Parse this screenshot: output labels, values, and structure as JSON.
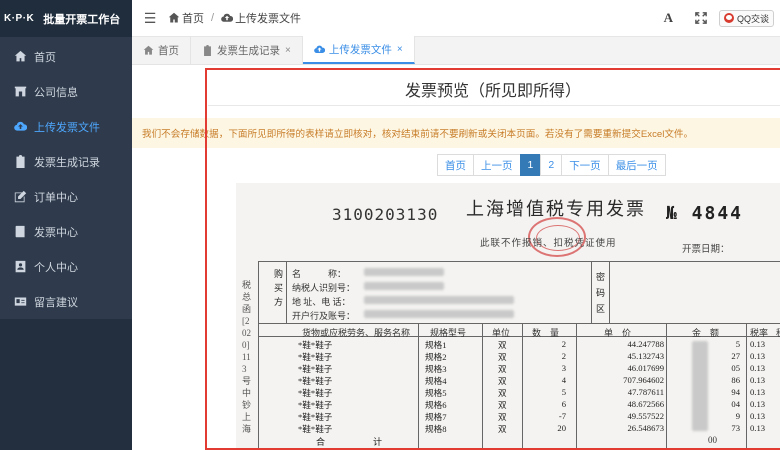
{
  "app": {
    "logo": "K·P·K",
    "title": "批量开票工作台"
  },
  "sidebar": {
    "items": [
      {
        "label": "首页",
        "icon": "home-icon"
      },
      {
        "label": "公司信息",
        "icon": "building-icon"
      },
      {
        "label": "上传发票文件",
        "icon": "cloud-upload-icon"
      },
      {
        "label": "发票生成记录",
        "icon": "clipboard-icon"
      },
      {
        "label": "订单中心",
        "icon": "edit-icon"
      },
      {
        "label": "发票中心",
        "icon": "book-icon"
      },
      {
        "label": "个人中心",
        "icon": "user-icon"
      },
      {
        "label": "留言建议",
        "icon": "id-card-icon"
      }
    ],
    "active_index": 2
  },
  "topbar": {
    "breadcrumb_home": "首页",
    "breadcrumb_current": "上传发票文件",
    "font_button": "A",
    "qq_label": "QQ交谈"
  },
  "tabs": [
    {
      "label": "首页",
      "closable": false
    },
    {
      "label": "发票生成记录",
      "closable": true,
      "close": "×"
    },
    {
      "label": "上传发票文件",
      "closable": true,
      "close": "×",
      "active": true
    }
  ],
  "main": {
    "title": "发票预览（所见即所得）",
    "notice": "我们不会存储数据，下面所见即所得的表样请立即核对，核对结束前请不要刷新或关闭本页面。若没有了需要重新提交Excel文件。",
    "pagination": [
      "首页",
      "上一页",
      "1",
      "2",
      "下一页",
      "最后一页"
    ],
    "current_page": "1"
  },
  "invoice": {
    "code": "3100203130",
    "title": "上海增值税专用发票",
    "number": "№ 4844",
    "subtitle": "此联不作报销、扣税凭证使用",
    "date_label": "开票日期：",
    "side_text": "税总函[2020]113号中钞上海",
    "buyer_label": "购买方",
    "buyer_fields": [
      "名　　　称：",
      "纳税人识别号：",
      "地 址、电 话：",
      "开户行及账号："
    ],
    "password_label": "密码区",
    "headers": [
      "货物或应税劳务、服务名称",
      "规格型号",
      "单位",
      "数　量",
      "单　价",
      "金　额",
      "税率",
      "税"
    ],
    "rows": [
      {
        "name": "*鞋*鞋子",
        "spec": "规格1",
        "unit": "双",
        "qty": "2",
        "price": "44.247788",
        "amt": "5",
        "rate": "0.13"
      },
      {
        "name": "*鞋*鞋子",
        "spec": "规格2",
        "unit": "双",
        "qty": "2",
        "price": "45.132743",
        "amt": "27",
        "rate": "0.13"
      },
      {
        "name": "*鞋*鞋子",
        "spec": "规格3",
        "unit": "双",
        "qty": "3",
        "price": "46.017699",
        "amt": "05",
        "rate": "0.13"
      },
      {
        "name": "*鞋*鞋子",
        "spec": "规格4",
        "unit": "双",
        "qty": "4",
        "price": "707.964602",
        "amt": "86",
        "rate": "0.13"
      },
      {
        "name": "*鞋*鞋子",
        "spec": "规格5",
        "unit": "双",
        "qty": "5",
        "price": "47.787611",
        "amt": "94",
        "rate": "0.13"
      },
      {
        "name": "*鞋*鞋子",
        "spec": "规格6",
        "unit": "双",
        "qty": "6",
        "price": "48.672566",
        "amt": "04",
        "rate": "0.13"
      },
      {
        "name": "*鞋*鞋子",
        "spec": "规格7",
        "unit": "双",
        "qty": "-7",
        "price": "49.557522",
        "amt": "9",
        "rate": "0.13"
      },
      {
        "name": "*鞋*鞋子",
        "spec": "规格8",
        "unit": "双",
        "qty": "20",
        "price": "26.548673",
        "amt": "73",
        "rate": "0.13"
      }
    ],
    "total_label": "合　　计",
    "total_tail": "00"
  },
  "colors": {
    "sidebar_bg": "#2f3b4c",
    "accent": "#3a8ee6",
    "notice_text": "#c87e2a",
    "highlight_border": "#e23b32"
  }
}
